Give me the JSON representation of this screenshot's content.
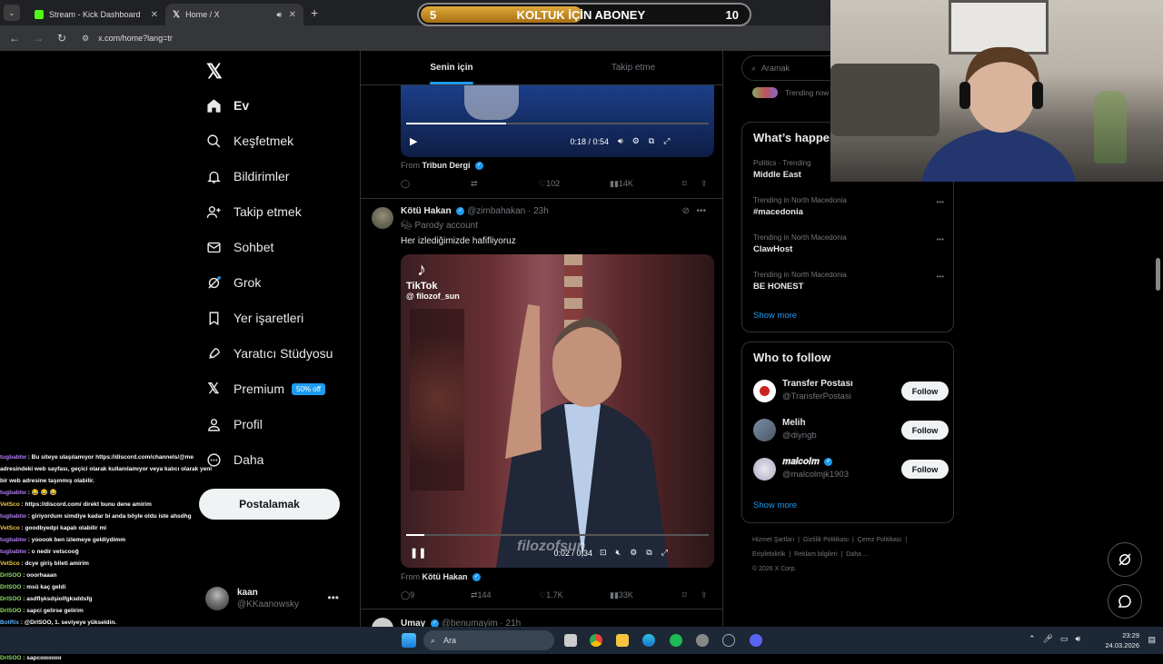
{
  "browser": {
    "tabs": [
      {
        "title": "Stream - Kick Dashboard",
        "icon": "kick-icon"
      },
      {
        "title": "Home / X",
        "icon": "x-icon"
      }
    ],
    "url": "x.com/home?lang=tr"
  },
  "overlay_goal": {
    "left": "5",
    "label": "KOLTUK İÇİN ABONEY",
    "right": "10",
    "progress": 0.5
  },
  "leftnav": {
    "items": [
      {
        "label": "Ev",
        "icon": "home-icon"
      },
      {
        "label": "Keşfetmek",
        "icon": "search-icon"
      },
      {
        "label": "Bildirimler",
        "icon": "bell-icon"
      },
      {
        "label": "Takip etmek",
        "icon": "person-add-icon"
      },
      {
        "label": "Sohbet",
        "icon": "mail-icon"
      },
      {
        "label": "Grok",
        "icon": "grok-icon"
      },
      {
        "label": "Yer işaretleri",
        "icon": "bookmark-icon"
      },
      {
        "label": "Yaratıcı Stüdyosu",
        "icon": "rocket-icon"
      },
      {
        "label": "Premium",
        "icon": "x-icon"
      },
      {
        "label": "Profil",
        "icon": "profile-icon"
      },
      {
        "label": "Daha",
        "icon": "more-circle-icon"
      }
    ],
    "premium_badge": "50% off",
    "post_button": "Postalamak",
    "account": {
      "name": "kaan",
      "handle": "@KKaanowsky"
    }
  },
  "feed": {
    "tabs": [
      "Senin için",
      "Takip etme"
    ],
    "video1": {
      "time": "0:18 / 0:54",
      "progress": 0.33,
      "from_label": "From",
      "from_name": "Tribun Dergi"
    },
    "tweet1_actions": {
      "replies": "",
      "retweets": "",
      "likes": "102",
      "views": "14K"
    },
    "tweet2": {
      "name": "Kötü Hakan",
      "handle": "@zimbahakan",
      "time": "23h",
      "parody": "Parody account",
      "text": "Her izlediğimizde hafifliyoruz",
      "tiktok_brand": "TikTok",
      "tiktok_user": "@ filozof_sun",
      "watermark": "filozofsun",
      "video_time": "0:02 / 0:34",
      "video_progress": 0.06,
      "from_label": "From",
      "from_name": "Kötü Hakan",
      "actions": {
        "replies": "9",
        "retweets": "144",
        "likes": "1.7K",
        "views": "33K"
      }
    },
    "tweet3": {
      "name": "Umay",
      "handle": "@benumayim",
      "time": "21h"
    }
  },
  "right": {
    "search_placeholder": "Aramak",
    "trending_now": "Trending now",
    "whats_happening": "What’s happening",
    "trends": [
      {
        "meta": "Politics · Trending",
        "name": "Middle East"
      },
      {
        "meta": "Trending in North Macedonia",
        "name": "#macedonia"
      },
      {
        "meta": "Trending in North Macedonia",
        "name": "ClawHost"
      },
      {
        "meta": "Trending in North Macedonia",
        "name": "BE HONEST"
      }
    ],
    "show_more": "Show more",
    "who_to_follow": "Who to follow",
    "follow_suggestions": [
      {
        "name": "Transfer Postası",
        "handle": "@TransferPostasi",
        "button": "Follow"
      },
      {
        "name": "Melih",
        "handle": "@diyngb",
        "button": "Follow"
      },
      {
        "name": "𝒎𝒂𝒍𝒄𝒐𝒍𝒎",
        "handle": "@malcolmjk1903",
        "button": "Follow"
      }
    ],
    "show_more2": "Show more",
    "footer": [
      "Hizmet Şartları",
      "Gizlilik Politikası",
      "Çerez Politikası",
      "Erişilebilirlik",
      "Reklam bilgileri",
      "Daha ...",
      "© 2026 X Corp."
    ]
  },
  "chat": [
    {
      "user": "tugbabtw",
      "msg": " : Bu siteye ulaşılamıyor https://discord.com/channels/@me adresindeki web sayfası, geçici olarak kullanılamıyor veya kalıcı olarak yeni bir web adresine taşınmış olabilir.",
      "cls": "u1"
    },
    {
      "user": "tugbabtw",
      "msg": " : 😂 😂 😂",
      "cls": "u1"
    },
    {
      "user": "VetSco",
      "msg": " : https://discord.com/ direkt bunu dene amirim",
      "cls": "u2"
    },
    {
      "user": "tugbabtw",
      "msg": " : giriyordum simdiye kadar bi anda böyle oldu iste ahsdhg",
      "cls": "u1"
    },
    {
      "user": "VetSco",
      "msg": " : goodbyedpi kapalı olabilir mi",
      "cls": "u2"
    },
    {
      "user": "tugbabtw",
      "msg": " : yooook ben izlemeye geldiydimm",
      "cls": "u1"
    },
    {
      "user": "tugbabtw",
      "msg": " : o nedir vetscooğ",
      "cls": "u1"
    },
    {
      "user": "VetSco",
      "msg": " : dcye giriş bileti amirim",
      "cls": "u2"
    },
    {
      "user": "DrlSOO",
      "msg": " : ooorhaaan",
      "cls": "u3"
    },
    {
      "user": "DrlSOO",
      "msg": " : msü kaç geldi",
      "cls": "u3"
    },
    {
      "user": "DrlSOO",
      "msg": " : asdflşksdşiolfgksddsfg",
      "cls": "u3"
    },
    {
      "user": "DrlSOO",
      "msg": " : sapci gelirse gelirim",
      "cls": "u3"
    },
    {
      "user": "BotRix",
      "msg": " : @DrlSOO, 1. seviyeye yükseldin.",
      "cls": "u4"
    },
    {
      "user": "DrlSOO",
      "msg": " : şıkıntı küçük",
      "cls": "u3"
    },
    {
      "user": "DrlSOO",
      "msg": " : Bööe mq",
      "cls": "u3"
    },
    {
      "user": "DrlSOO",
      "msg": " : sapcııııııııııııı",
      "cls": "u3"
    }
  ],
  "taskbar": {
    "search": "Ara",
    "time": "23:29",
    "date": "24.03.2026"
  },
  "colors": {
    "accent": "#1d9bf0",
    "background": "#000000",
    "border": "#2f3336",
    "muted": "#71767b"
  }
}
